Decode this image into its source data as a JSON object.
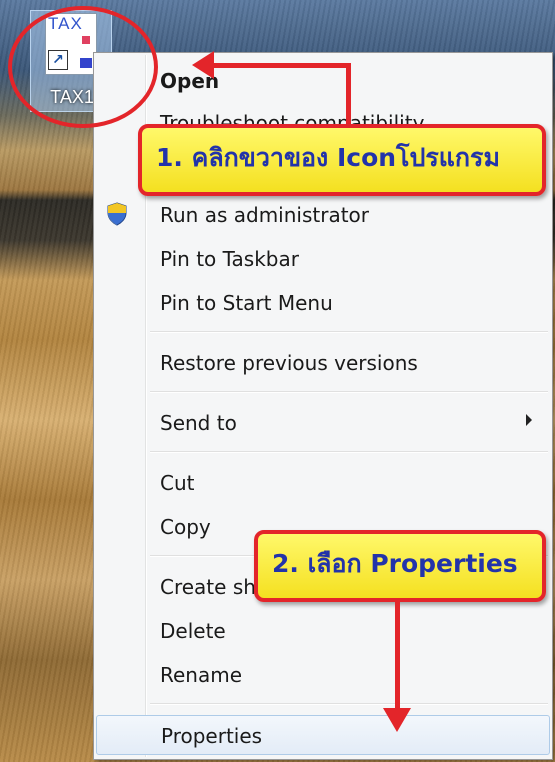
{
  "desktop_icon": {
    "label": "TAX1",
    "icon_text": "TAX",
    "shortcut_glyph": "↗"
  },
  "menu": {
    "items": [
      {
        "label": "Open",
        "bold": true
      },
      {
        "label": "Troubleshoot compatibility"
      },
      {
        "label": "Run as administrator",
        "icon": "shield-icon"
      },
      {
        "label": "Pin to Taskbar"
      },
      {
        "label": "Pin to Start Menu"
      },
      {
        "label": "Restore previous versions"
      },
      {
        "label": "Send to",
        "submenu": true
      },
      {
        "label": "Cut"
      },
      {
        "label": "Copy"
      },
      {
        "label": "Create shortcut"
      },
      {
        "label": "Delete"
      },
      {
        "label": "Rename"
      },
      {
        "label": "Properties",
        "highlighted": true
      }
    ]
  },
  "annotations": {
    "step1": "1. คลิกขวาของ Iconโปรแกรม",
    "step2": "2. เลือก Properties",
    "color": "#e3252a",
    "callout_bg": "#f8ec3a"
  }
}
